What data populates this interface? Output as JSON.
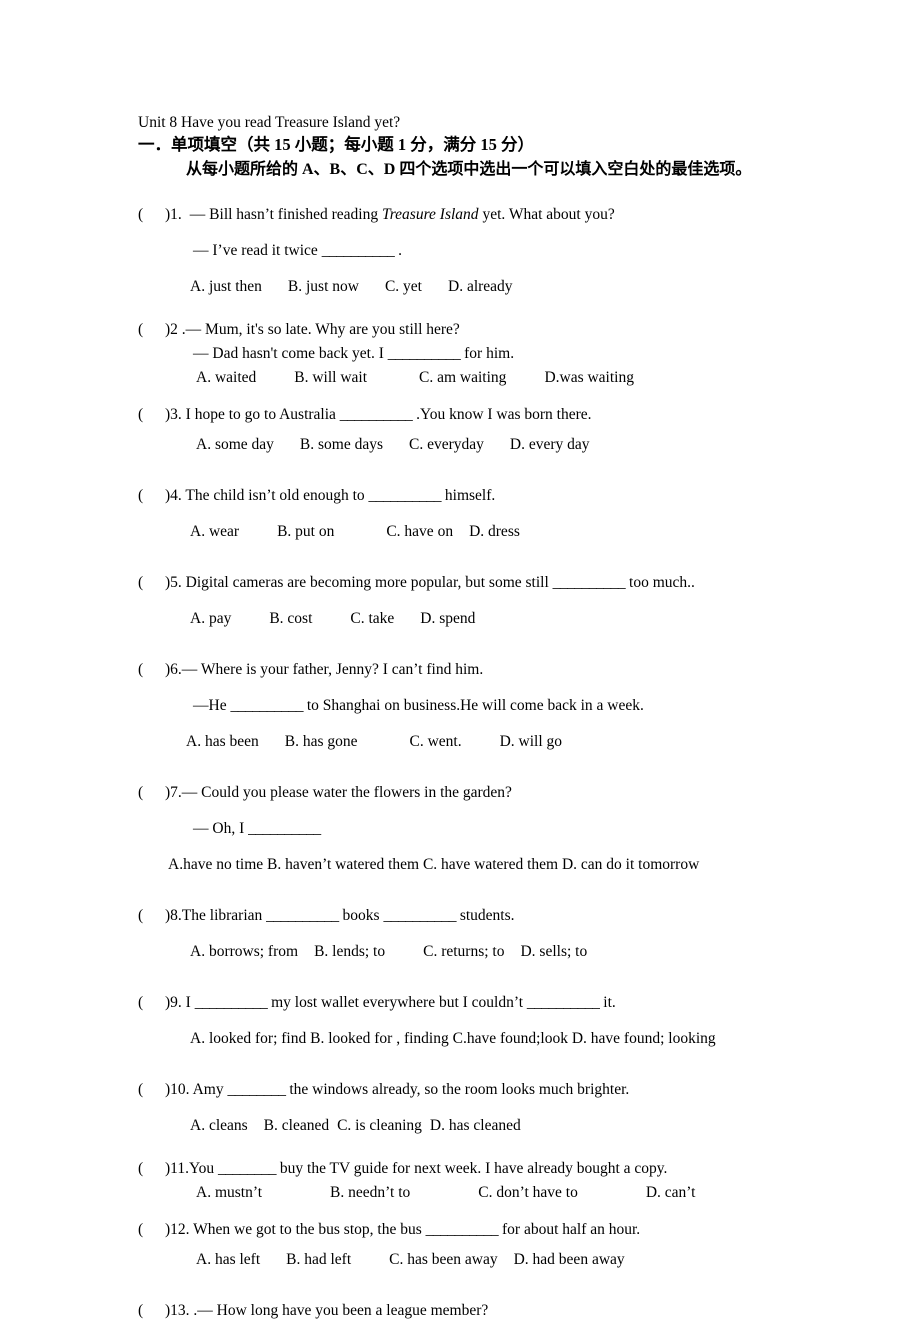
{
  "document": {
    "title": "Unit 8 Have you read Treasure Island yet?",
    "section_heading": "一．单项填空（共 15 小题；每小题 1 分，满分 15 分）",
    "section_instruction": "从每小题所给的 A、B、C、D 四个选项中选出一个可以填入空白处的最佳选项。",
    "blank": "__________",
    "blank_short": "________",
    "marker_open": "(",
    "marker_close": ")"
  },
  "questions": [
    {
      "number": "1.",
      "stem_pre": "— Bill hasn’t finished reading ",
      "stem_italic": "Treasure Island",
      "stem_post": " yet. What about you?",
      "line2_pre": "— I’ve read it twice  ",
      "line2_post": " .",
      "options": [
        "A. just  then",
        "B. just now",
        "C. yet",
        "D. already"
      ]
    },
    {
      "number": "2 .",
      "stem": "— Mum, it's so late. Why are you still here?",
      "line2_pre": "— Dad hasn't come back yet. I ",
      "line2_post": " for him.",
      "options": [
        "A. waited",
        "B. will wait",
        "C. am waiting",
        "D.was waiting"
      ]
    },
    {
      "number": "3.",
      "stem_pre": " I hope to go to Australia ",
      "stem_post": " .You know I was born there.",
      "options": [
        "A. some day",
        "B. some days",
        "C. everyday",
        "D. every   day"
      ]
    },
    {
      "number": "4.",
      "stem_pre": " The child isn’t old enough to ",
      "stem_post": "  himself.",
      "options": [
        "A. wear",
        "B. put on",
        "C. have on",
        "D. dress"
      ]
    },
    {
      "number": "5.",
      "stem_pre": " Digital cameras are becoming more popular, but some still ",
      "stem_post": " too   much..",
      "options": [
        "A. pay",
        "B. cost",
        "C. take",
        "D. spend"
      ]
    },
    {
      "number": "6.",
      "stem": "— Where is your father, Jenny? I can’t find him.",
      "line2_pre": "—He ",
      "line2_post": " to Shanghai on business.He will come back in a week.",
      "options": [
        "A. has been",
        "B. has gone",
        "C. went.",
        "D. will go"
      ]
    },
    {
      "number": "7.",
      "stem": "— Could you please water the flowers in the garden?",
      "line2_pre": "— Oh, I ",
      "line2_post": "",
      "options_line": "A.have no time  B. haven’t watered them  C. have watered them  D. can do it tomorrow"
    },
    {
      "number": "8.",
      "stem_pre": "The librarian ",
      "stem_mid": " books ",
      "stem_post": " students.",
      "options": [
        "A. borrows; from",
        "B. lends; to",
        "C. returns; to",
        "D. sells; to"
      ]
    },
    {
      "number": "9.",
      "stem_pre": " I ",
      "stem_mid": " my lost wallet everywhere but I couldn’t ",
      "stem_post": " it.",
      "options_line": "A. looked for; find  B. looked for ,  finding  C.have found;look D. have found; looking"
    },
    {
      "number": "10.",
      "stem_pre": " Amy ",
      "stem_post": " the windows already, so the room looks much brighter.",
      "options": [
        "A. cleans",
        "B. cleaned",
        "C. is cleaning",
        "D. has cleaned"
      ]
    },
    {
      "number": "11.",
      "stem_pre": "You ",
      "stem_post": " buy the TV guide for next week. I have already bought a copy.",
      "options": [
        "A. mustn’t",
        "B. needn’t to",
        "C. don’t have to",
        "D. can’t"
      ]
    },
    {
      "number": "12.",
      "stem_pre": " When we got to the bus stop, the bus ",
      "stem_post": "  for about half an hour.",
      "options": [
        "A. has left",
        "B. had left",
        "C. has been away",
        "D. had been away"
      ]
    },
    {
      "number": "13.",
      "stem": " .— How long have you been a league member?"
    }
  ]
}
